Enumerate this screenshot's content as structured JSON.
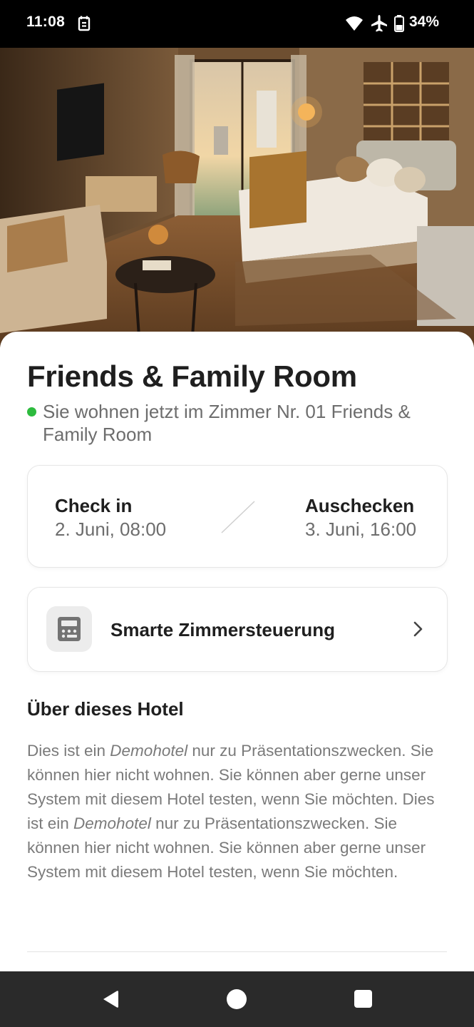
{
  "status_bar": {
    "time": "11:08",
    "battery_percent": "34%",
    "icons": [
      "calendar-icon",
      "wifi-icon",
      "airplane-mode-icon",
      "battery-icon"
    ]
  },
  "hero": {
    "image": "hotel-room-photo"
  },
  "room": {
    "title": "Friends & Family Room",
    "status_text": "Sie wohnen jetzt im Zimmer Nr. 01 Friends & Family Room",
    "status_color": "#2dbb3e"
  },
  "stay": {
    "checkin_label": "Check in",
    "checkin_value": "2. Juni, 08:00",
    "checkout_label": "Auschecken",
    "checkout_value": "3. Juni, 16:00"
  },
  "smart_control": {
    "label": "Smarte Zimmersteuerung",
    "icon": "room-control-icon"
  },
  "about": {
    "heading": "Über dieses Hotel",
    "p1_a": "Dies ist ein ",
    "p1_em": "Demohotel",
    "p1_b": " nur zu Präsentationszwecken. Sie können hier nicht wohnen. Sie können aber gerne unser System mit diesem Hotel testen, wenn Sie möchten. Dies ist ein ",
    "p2_em": "Demohotel",
    "p2_b": " nur zu Präsentationszwecken. Sie können hier nicht wohnen. Sie können aber gerne unser System mit diesem Hotel testen, wenn Sie möchten."
  },
  "nav_bar": {
    "buttons": [
      "back-icon",
      "home-icon",
      "recents-icon"
    ]
  }
}
